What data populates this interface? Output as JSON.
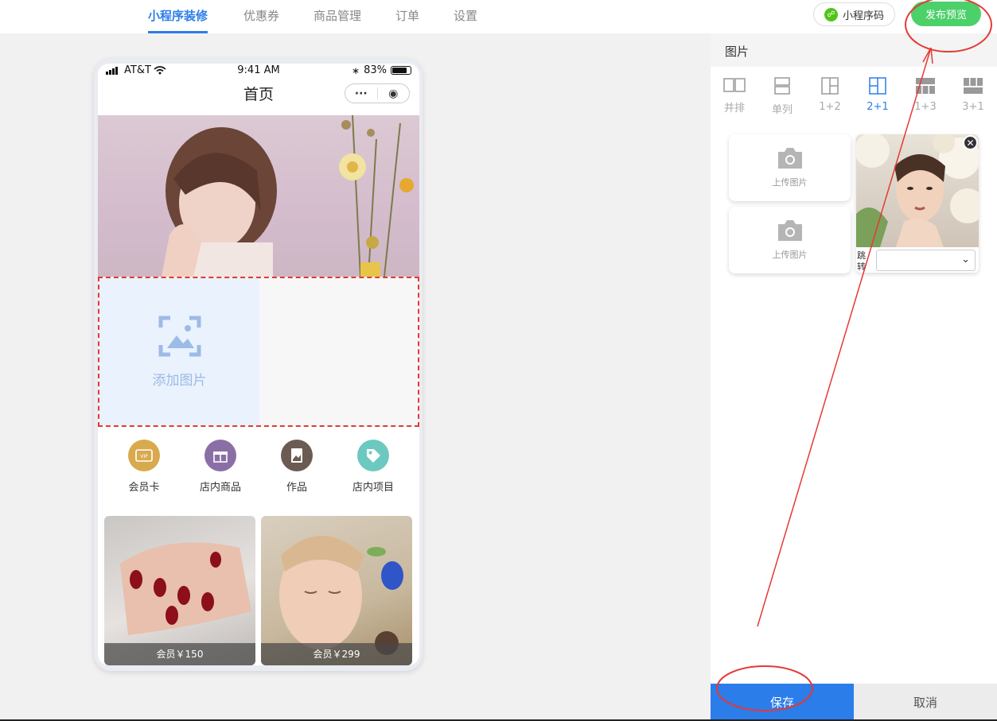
{
  "nav": {
    "tabs": [
      {
        "label": "小程序装修",
        "active": true
      },
      {
        "label": "优惠券"
      },
      {
        "label": "商品管理"
      },
      {
        "label": "订单"
      },
      {
        "label": "设置"
      }
    ],
    "qr_label": "小程序码",
    "publish_label": "发布预览"
  },
  "phone": {
    "carrier": "AT&T",
    "time": "9:41 AM",
    "battery": "83%",
    "title": "首页",
    "capsule_more": "···",
    "add_image_label": "添加图片",
    "menu": [
      {
        "label": "会员卡",
        "icon": "vip-card-icon",
        "color": "#d9a94e"
      },
      {
        "label": "店内商品",
        "icon": "gift-icon",
        "color": "#8a6fa6"
      },
      {
        "label": "作品",
        "icon": "photo-icon",
        "color": "#6b5b52"
      },
      {
        "label": "店内项目",
        "icon": "tag-icon",
        "color": "#6cc9c0"
      }
    ],
    "cards": [
      {
        "price": "会员￥150"
      },
      {
        "price": "会员￥299"
      }
    ]
  },
  "panel": {
    "title": "图片",
    "layouts": [
      {
        "label": "并排"
      },
      {
        "label": "单列"
      },
      {
        "label": "1+2"
      },
      {
        "label": "2+1",
        "active": true
      },
      {
        "label": "1+3"
      },
      {
        "label": "3+1"
      }
    ],
    "upload_label": "上传图片",
    "jump_label": "跳转",
    "save_label": "保存",
    "cancel_label": "取消"
  },
  "colors": {
    "accent": "#2b7de9",
    "publish": "#4cd06a",
    "annotation": "#e53935"
  }
}
